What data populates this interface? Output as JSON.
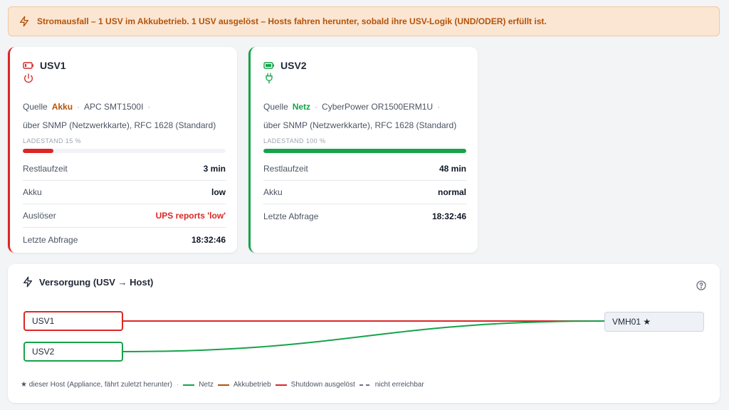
{
  "alert": {
    "text": "Stromausfall – 1 USV im Akkubetrieb. 1 USV ausgelöst – Hosts fahren herunter, sobald ihre USV-Logik (UND/ODER) erfüllt ist."
  },
  "ups": [
    {
      "name": "USV1",
      "source_label": "Quelle",
      "source_value": "Akku",
      "model": "APC SMT1500I",
      "connection": "über SNMP (Netzwerkkarte), RFC 1628 (Standard)",
      "charge_label": "LADESTAND 15 %",
      "charge_percent": 15,
      "rows": [
        {
          "k": "Restlaufzeit",
          "v": "3 min"
        },
        {
          "k": "Akku",
          "v": "low"
        },
        {
          "k": "Auslöser",
          "v": "UPS reports 'low'"
        },
        {
          "k": "Letzte Abfrage",
          "v": "18:32:46"
        }
      ]
    },
    {
      "name": "USV2",
      "source_label": "Quelle",
      "source_value": "Netz",
      "model": "CyberPower OR1500ERM1U",
      "connection": "über SNMP (Netzwerkkarte), RFC 1628 (Standard)",
      "charge_label": "LADESTAND 100 %",
      "charge_percent": 100,
      "rows": [
        {
          "k": "Restlaufzeit",
          "v": "48 min"
        },
        {
          "k": "Akku",
          "v": "normal"
        },
        {
          "k": "Letzte Abfrage",
          "v": "18:32:46"
        }
      ]
    }
  ],
  "flow": {
    "title": "Versorgung (USV → Host)",
    "nodes": {
      "ups1": "USV1",
      "ups2": "USV2",
      "host": "VMH01 ★"
    },
    "legend": {
      "this_host": "★  dieser Host (Appliance, fährt zuletzt herunter)",
      "net": "Netz",
      "battery": "Akkubetrieb",
      "shutdown": "Shutdown ausgelöst",
      "unreachable": "nicht erreichbar"
    }
  },
  "colors": {
    "danger": "#dc2626",
    "ok": "#16a34a",
    "battery": "#b45309",
    "alert_bg": "#fbe6d3"
  }
}
